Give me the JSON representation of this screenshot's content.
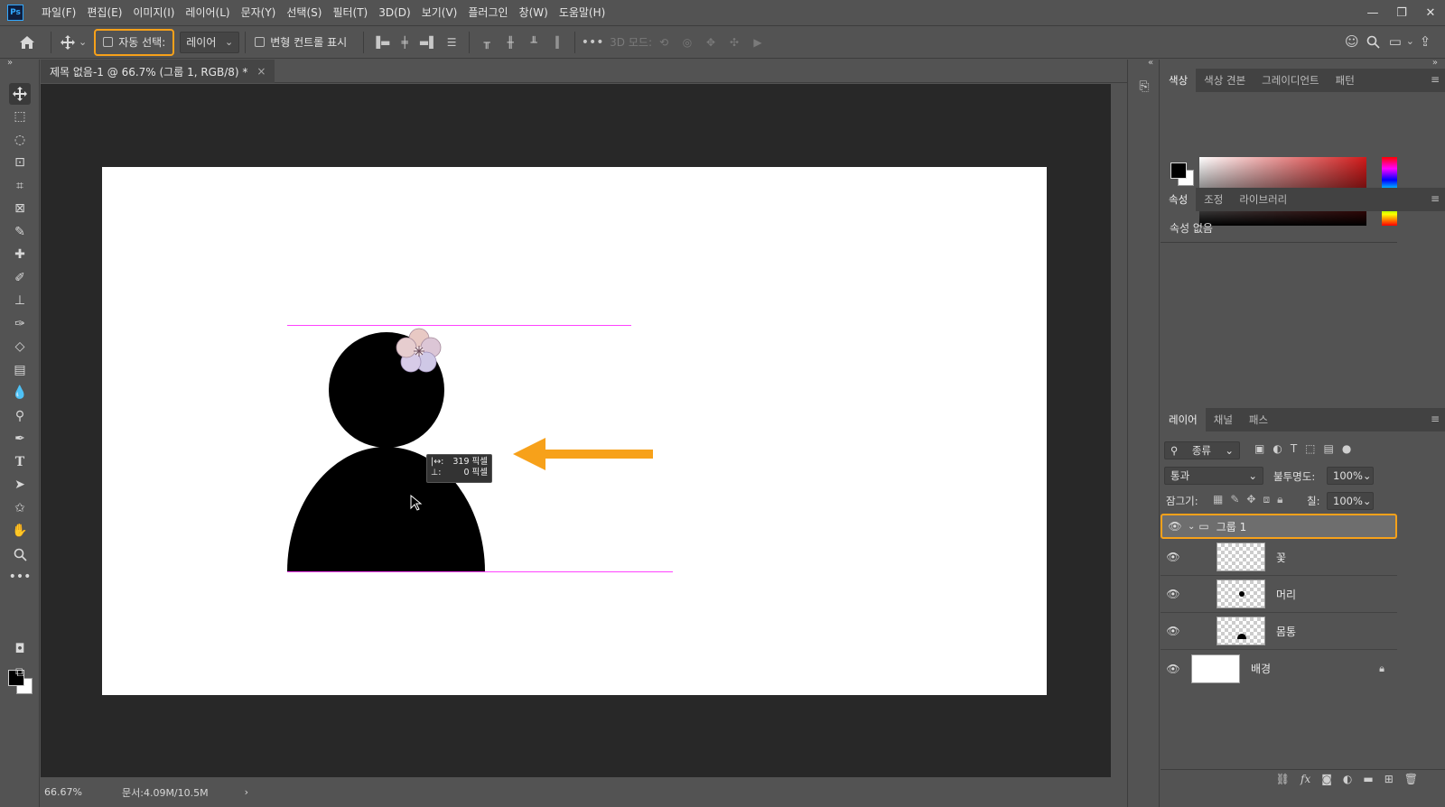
{
  "menubar": {
    "logo": "Ps",
    "items": [
      "파일(F)",
      "편집(E)",
      "이미지(I)",
      "레이어(L)",
      "문자(Y)",
      "선택(S)",
      "필터(T)",
      "3D(D)",
      "보기(V)",
      "플러그인",
      "창(W)",
      "도움말(H)"
    ],
    "window_controls": [
      "—",
      "❐",
      "✕"
    ]
  },
  "options": {
    "auto_select_label": "자동 선택:",
    "auto_select_target": "레이어",
    "transform_controls_label": "변형 컨트롤 표시",
    "three_d_mode_label": "3D 모드:"
  },
  "document": {
    "tab_title": "제목 없음-1 @ 66.7% (그룹 1, RGB/8) *",
    "tab_close": "×",
    "zoom": "66.67%",
    "doc_info": "문서:4.09M/10.5M",
    "measure_h_label": "319 픽셀",
    "measure_v_label": "0 픽셀",
    "accent_color": "#f7a11a",
    "guide_color": "#ff43ff"
  },
  "color_panel": {
    "tabs": [
      "색상",
      "색상 견본",
      "그레이디언트",
      "패턴"
    ],
    "active_tab": "색상"
  },
  "properties_panel": {
    "tabs": [
      "속성",
      "조정",
      "라이브러리"
    ],
    "active_tab": "속성",
    "empty_text": "속성 없음"
  },
  "layers_panel": {
    "tabs": [
      "레이어",
      "채널",
      "패스"
    ],
    "active_tab": "레이어",
    "filter_label": "종류",
    "blend_mode": "통과",
    "opacity_label": "불투명도:",
    "opacity_value": "100%",
    "lock_label": "잠그기:",
    "fill_label": "칠:",
    "fill_value": "100%",
    "layers": [
      {
        "name": "그룹 1",
        "type": "group",
        "selected": true
      },
      {
        "name": "꽃",
        "type": "layer"
      },
      {
        "name": "머리",
        "type": "layer"
      },
      {
        "name": "몸통",
        "type": "layer"
      },
      {
        "name": "배경",
        "type": "background",
        "locked": true
      }
    ]
  }
}
